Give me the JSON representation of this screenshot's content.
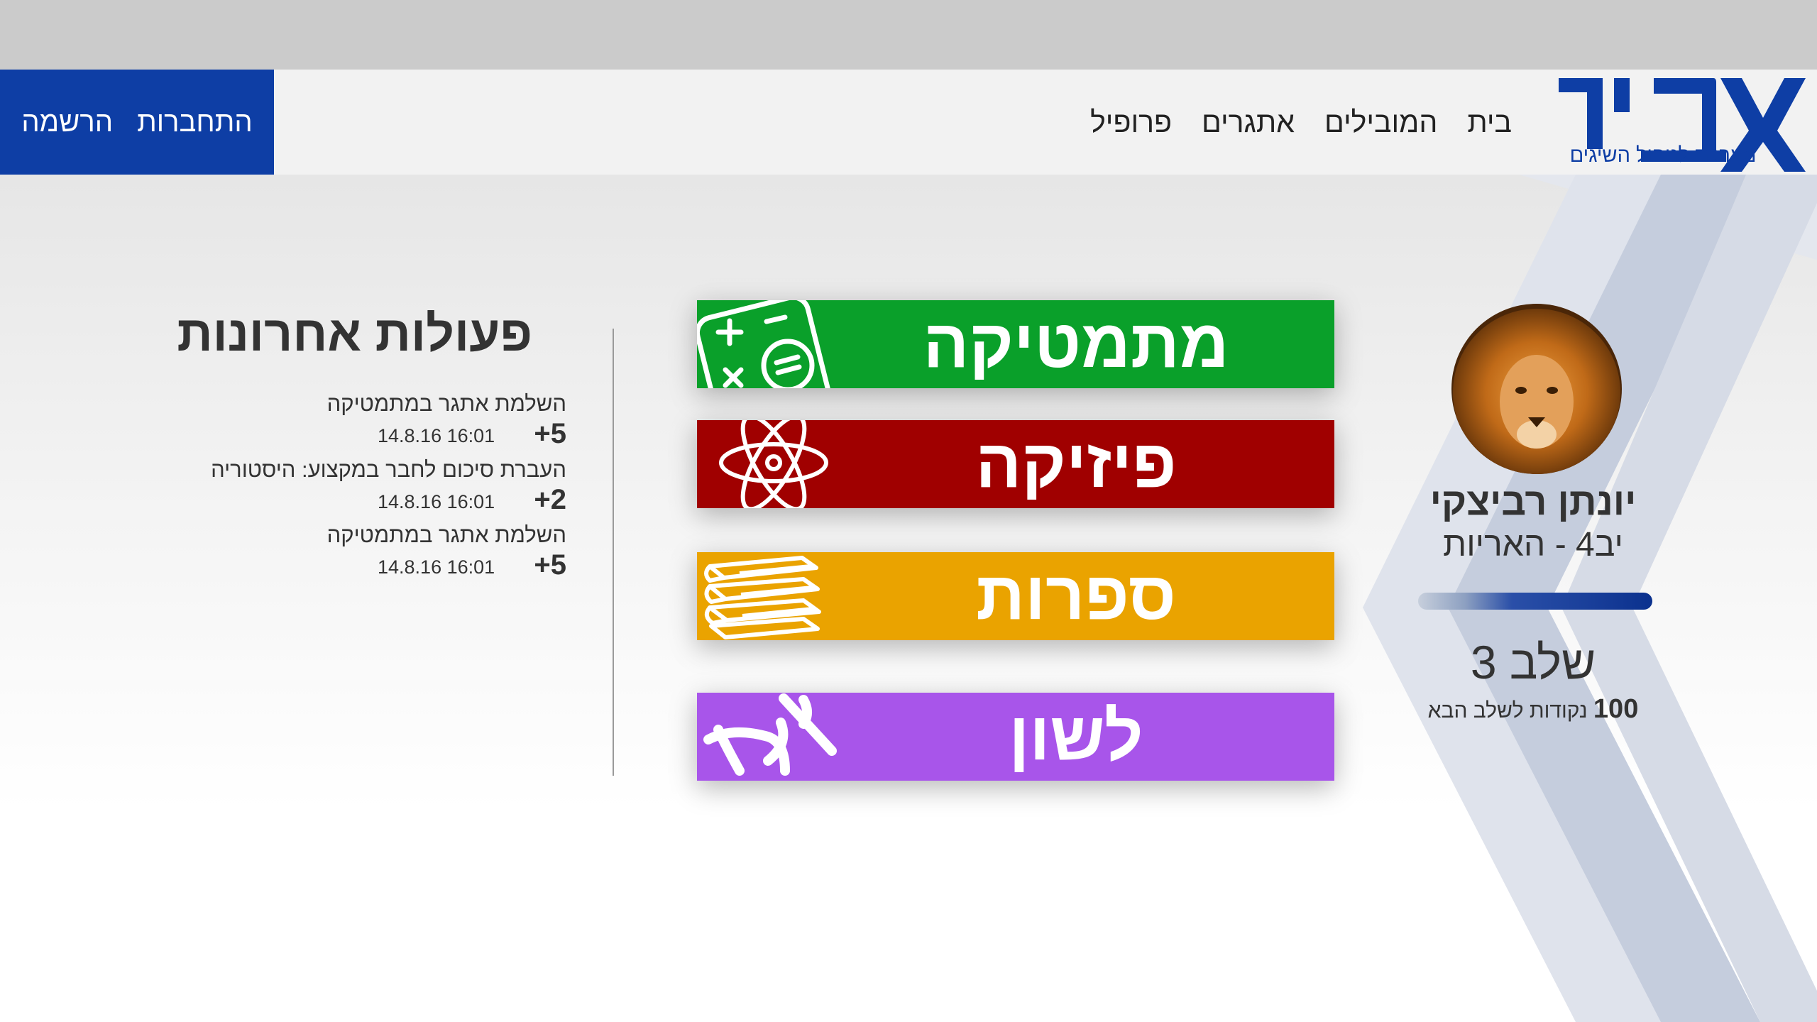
{
  "brand": {
    "logo_text": "אבין",
    "subtitle": "מערכת לניהול השיגים",
    "primary_color": "#0e3ea5"
  },
  "nav": [
    {
      "label": "בית"
    },
    {
      "label": "המובילים"
    },
    {
      "label": "אתגרים"
    },
    {
      "label": "פרופיל"
    }
  ],
  "auth": {
    "login_label": "התחברות",
    "register_label": "הרשמה"
  },
  "profile": {
    "name": "יונתן רביצקי",
    "group": "יב4 - האריות",
    "avatar_icon": "lion-avatar",
    "level": "שלב 3",
    "next_level_points": "100",
    "next_level_text": "נקודות לשלב הבא"
  },
  "subjects": [
    {
      "label": "מתמטיקה",
      "color": "#0aa02a",
      "icon": "calculator-icon"
    },
    {
      "label": "פיזיקה",
      "color": "#a00000",
      "icon": "atom-icon"
    },
    {
      "label": "ספרות",
      "color": "#eaa300",
      "icon": "books-icon"
    },
    {
      "label": "לשון",
      "color": "#a855ea",
      "icon": "hebrew-letters-icon"
    }
  ],
  "recent": {
    "title": "פעולות אחרונות",
    "items": [
      {
        "desc": "השלמת אתגר במתמטיקה",
        "time": "14.8.16 16:01",
        "points": "+5"
      },
      {
        "desc": "העברת סיכום לחבר במקצוע: היסטוריה",
        "time": "14.8.16 16:01",
        "points": "+2"
      },
      {
        "desc": "השלמת אתגר במתמטיקה",
        "time": "14.8.16 16:01",
        "points": "+5"
      }
    ]
  }
}
